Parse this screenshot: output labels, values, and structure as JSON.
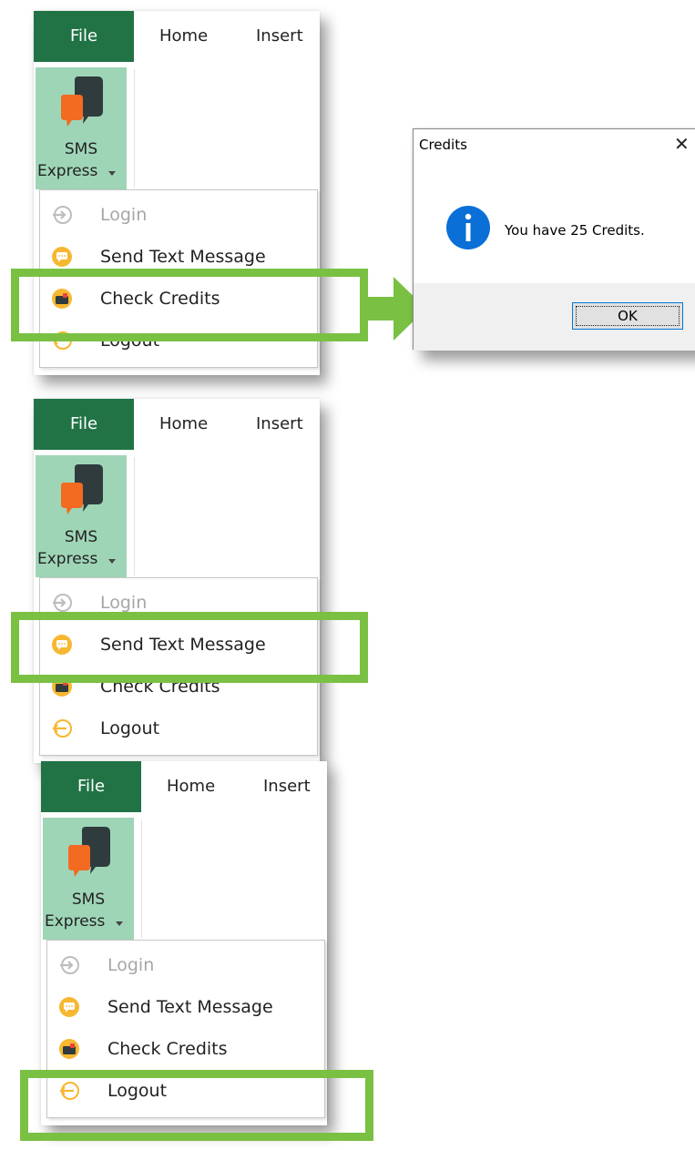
{
  "ribbon": {
    "tabs": {
      "file": "File",
      "home": "Home",
      "insert": "Insert"
    },
    "sms_button": {
      "line1": "SMS",
      "line2": "Express"
    }
  },
  "menu": {
    "items": [
      {
        "label": "Login",
        "state": "disabled",
        "icon": "login-arrow-icon"
      },
      {
        "label": "Send Text Message",
        "state": "enabled",
        "icon": "speech-bubble-icon"
      },
      {
        "label": "Check Credits",
        "state": "enabled",
        "icon": "wallet-icon"
      },
      {
        "label": "Logout",
        "state": "enabled",
        "icon": "logout-arrow-icon"
      }
    ]
  },
  "panels": [
    {
      "highlighted_item": "Check Credits"
    },
    {
      "highlighted_item": "Send Text Message"
    },
    {
      "highlighted_item": "Logout"
    }
  ],
  "dialog": {
    "title": "Credits",
    "message": "You have 25 Credits.",
    "ok_label": "OK",
    "icon": "info-icon"
  },
  "colors": {
    "file_tab": "#217346",
    "sms_button_bg": "#9fd5b7",
    "highlight": "#7ac143",
    "info_icon": "#0a6fd6"
  }
}
